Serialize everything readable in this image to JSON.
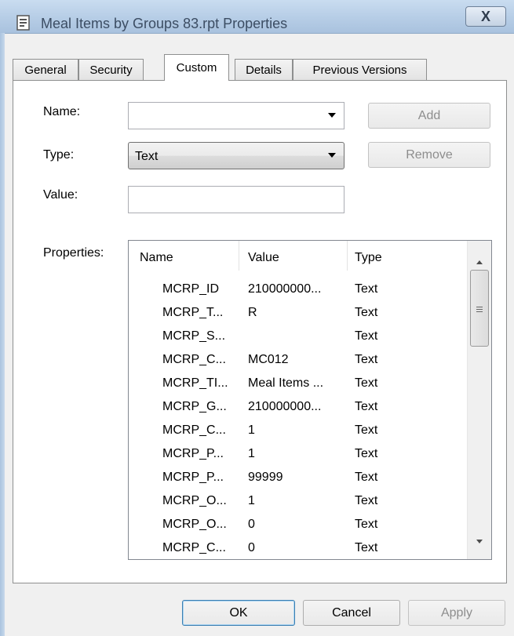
{
  "window": {
    "title": "Meal Items by Groups 83.rpt Properties",
    "close_label": "X"
  },
  "tabs": [
    "General",
    "Security",
    "Custom",
    "Details",
    "Previous Versions"
  ],
  "active_tab": "Custom",
  "form": {
    "name_label": "Name:",
    "name_value": "",
    "type_label": "Type:",
    "type_value": "Text",
    "value_label": "Value:",
    "value_value": "",
    "properties_label": "Properties:",
    "add_label": "Add",
    "remove_label": "Remove"
  },
  "properties": {
    "columns": [
      "Name",
      "Value",
      "Type"
    ],
    "rows": [
      [
        "MCRP_ID",
        "210000000...",
        "Text"
      ],
      [
        "MCRP_T...",
        "R",
        "Text"
      ],
      [
        "MCRP_S...",
        "",
        "Text"
      ],
      [
        "MCRP_C...",
        "MC012",
        "Text"
      ],
      [
        "MCRP_TI...",
        "Meal Items ...",
        "Text"
      ],
      [
        "MCRP_G...",
        "210000000...",
        "Text"
      ],
      [
        "MCRP_C...",
        "1",
        "Text"
      ],
      [
        "MCRP_P...",
        "1",
        "Text"
      ],
      [
        "MCRP_P...",
        "99999",
        "Text"
      ],
      [
        "MCRP_O...",
        "1",
        "Text"
      ],
      [
        "MCRP_O...",
        "0",
        "Text"
      ],
      [
        "MCRP_C...",
        "0",
        "Text"
      ]
    ]
  },
  "footer": {
    "ok_label": "OK",
    "cancel_label": "Cancel",
    "apply_label": "Apply"
  }
}
